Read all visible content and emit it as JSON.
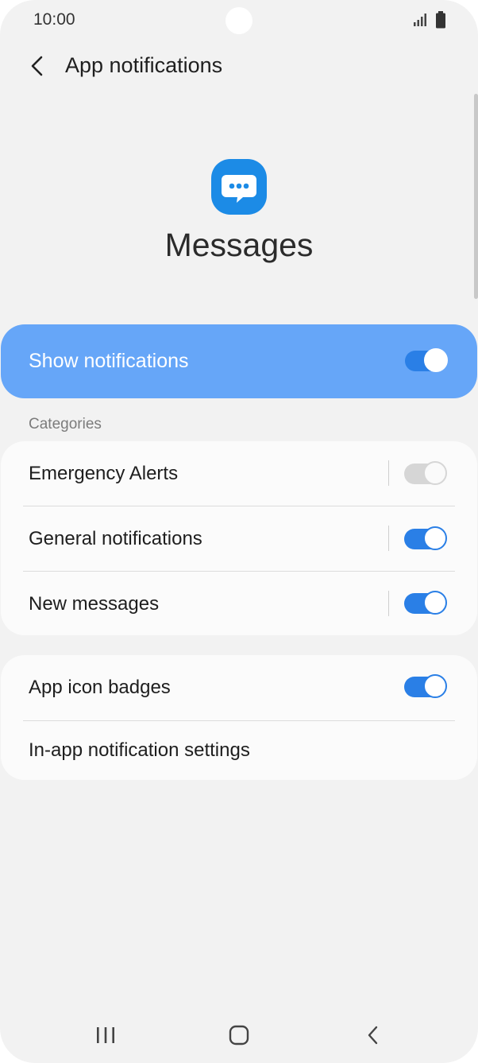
{
  "status_bar": {
    "time": "10:00",
    "signal_icon": "signal-icon",
    "battery_icon": "battery-icon"
  },
  "header": {
    "title": "App notifications",
    "back_icon": "back-arrow-icon"
  },
  "app": {
    "name": "Messages",
    "icon": "messages-app-icon",
    "icon_color": "#1c8be6"
  },
  "show_notifications": {
    "label": "Show notifications",
    "enabled": true,
    "card_color": "#66a6f8"
  },
  "categories": {
    "header": "Categories",
    "items": [
      {
        "label": "Emergency Alerts",
        "enabled": true,
        "disabled": true
      },
      {
        "label": "General notifications",
        "enabled": true,
        "disabled": false
      },
      {
        "label": "New messages",
        "enabled": true,
        "disabled": false
      }
    ]
  },
  "other_settings": {
    "items": [
      {
        "label": "App icon badges",
        "enabled": true
      },
      {
        "label": "In-app notification settings"
      }
    ]
  },
  "colors": {
    "accent": "#2a7fe6",
    "background": "#f2f2f2",
    "card": "#fbfbfb"
  },
  "nav_bar": {
    "recents_icon": "recents-icon",
    "home_icon": "home-icon",
    "back_icon": "nav-back-icon"
  }
}
